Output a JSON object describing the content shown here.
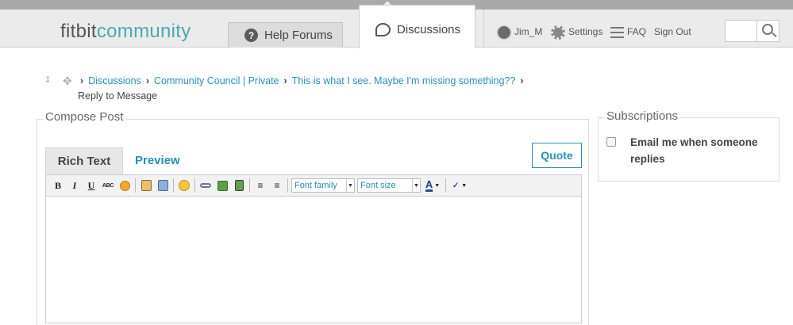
{
  "brand": {
    "part1": "fitbit",
    "part2": "community"
  },
  "nav": {
    "tabs": [
      {
        "label": "Help Forums",
        "icon": "question-circle-icon"
      },
      {
        "label": "Discussions",
        "icon": "chat-bubble-icon",
        "active": true
      }
    ]
  },
  "user_nav": {
    "username": "Jim_M",
    "settings": "Settings",
    "faq": "FAQ",
    "signout": "Sign Out"
  },
  "search": {
    "placeholder": "",
    "button_icon": "search-icon"
  },
  "breadcrumb": {
    "items": [
      "Discussions",
      "Community Council | Private",
      "This is what I see. Maybe I'm missing something??"
    ],
    "current": "Reply to Message"
  },
  "compose": {
    "legend": "Compose Post",
    "tabs": {
      "rich": "Rich Text",
      "preview": "Preview"
    },
    "quote_label": "Quote",
    "toolbar": {
      "bold": "B",
      "italic": "I",
      "underline": "U",
      "strike": "ABC",
      "font_family": "Font family",
      "font_size": "Font size",
      "font_color": "A"
    }
  },
  "subscriptions": {
    "legend": "Subscriptions",
    "email_label": "Email me when someone replies"
  },
  "colors": {
    "accent": "#2a8fb0",
    "brand_teal": "#4aa9b5",
    "header_bg": "#ebebeb"
  }
}
